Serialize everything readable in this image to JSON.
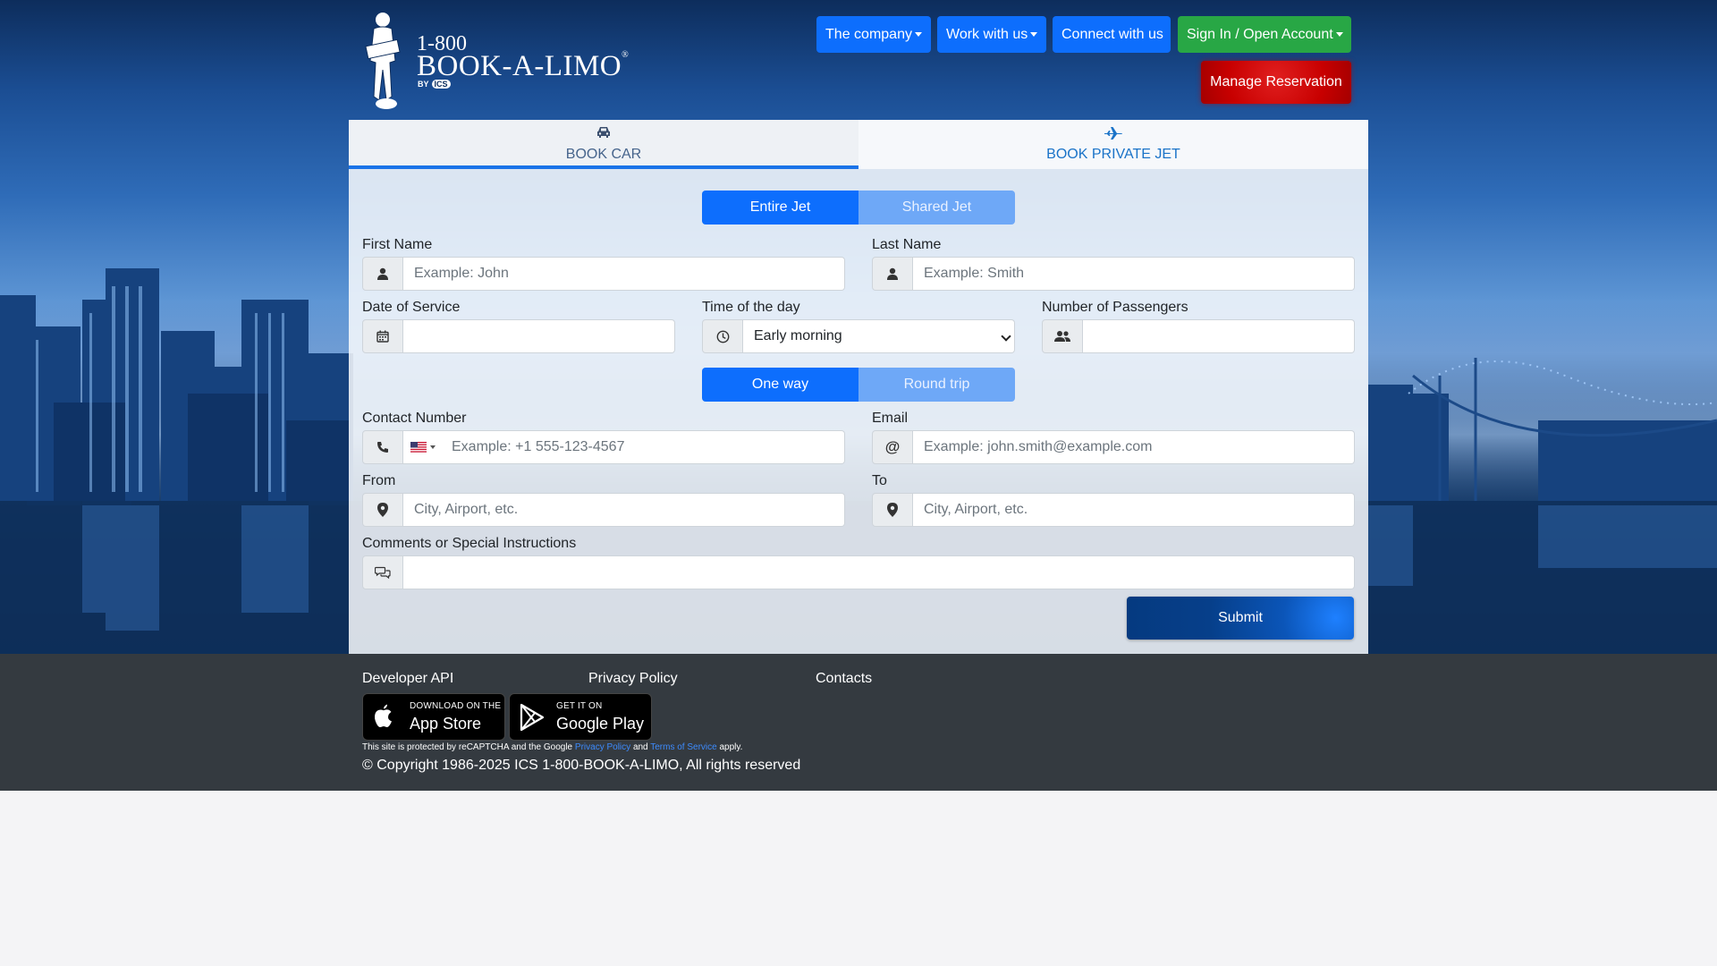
{
  "brand": {
    "line1": "1-800",
    "line2": "BOOK-A-LIMO",
    "registered": "®",
    "by": "BY",
    "ics": "ICS"
  },
  "nav": {
    "company": "The company",
    "work": "Work with us",
    "connect": "Connect with us",
    "signin": "Sign In / Open Account",
    "manage": "Manage Reservation"
  },
  "tabs": {
    "car": "BOOK CAR",
    "jet": "BOOK PRIVATE JET"
  },
  "jet_type": {
    "selected": "Entire Jet",
    "other": "Shared Jet"
  },
  "trip_type": {
    "selected": "One way",
    "other": "Round trip"
  },
  "form": {
    "first_name": {
      "label": "First Name",
      "placeholder": "Example: John",
      "icon": "user-icon"
    },
    "last_name": {
      "label": "Last Name",
      "placeholder": "Example: Smith",
      "icon": "user-icon"
    },
    "date": {
      "label": "Date of Service",
      "value": "",
      "icon": "calendar-icon"
    },
    "time": {
      "label": "Time of the day",
      "selected": "Early morning",
      "icon": "clock-icon"
    },
    "passengers": {
      "label": "Number of Passengers",
      "value": "",
      "icon": "users-icon"
    },
    "contact": {
      "label": "Contact Number",
      "placeholder": "Example: +1 555-123-4567",
      "icon": "phone-icon",
      "flag": "us-flag-icon"
    },
    "email": {
      "label": "Email",
      "placeholder": "Example: john.smith@example.com",
      "icon": "at-icon"
    },
    "from": {
      "label": "From",
      "placeholder": "City, Airport, etc.",
      "icon": "map-marker-icon"
    },
    "to": {
      "label": "To",
      "placeholder": "City, Airport, etc.",
      "icon": "map-marker-icon"
    },
    "comments": {
      "label": "Comments or Special Instructions",
      "value": "",
      "icon": "comments-icon"
    },
    "submit": "Submit"
  },
  "footer": {
    "dev_api": "Developer API",
    "privacy": "Privacy Policy",
    "contacts": "Contacts",
    "appstore_small": "DOWNLOAD ON THE",
    "appstore_big": "App Store",
    "gplay_small": "GET IT ON",
    "gplay_big": "Google Play",
    "recaptcha_pre": "This site is protected by reCAPTCHA and the Google",
    "recaptcha_privacy": "Privacy Policy",
    "recaptcha_and": "and",
    "recaptcha_terms": "Terms of Service",
    "recaptcha_post": "apply.",
    "copyright": "© Copyright 1986-2025 ICS 1-800-BOOK-A-LIMO, All rights reserved"
  },
  "colors": {
    "primary": "#0d6efd",
    "green": "#28a745",
    "red": "#c80000",
    "footer": "#343a40",
    "tab_text": "#1a73c8"
  }
}
